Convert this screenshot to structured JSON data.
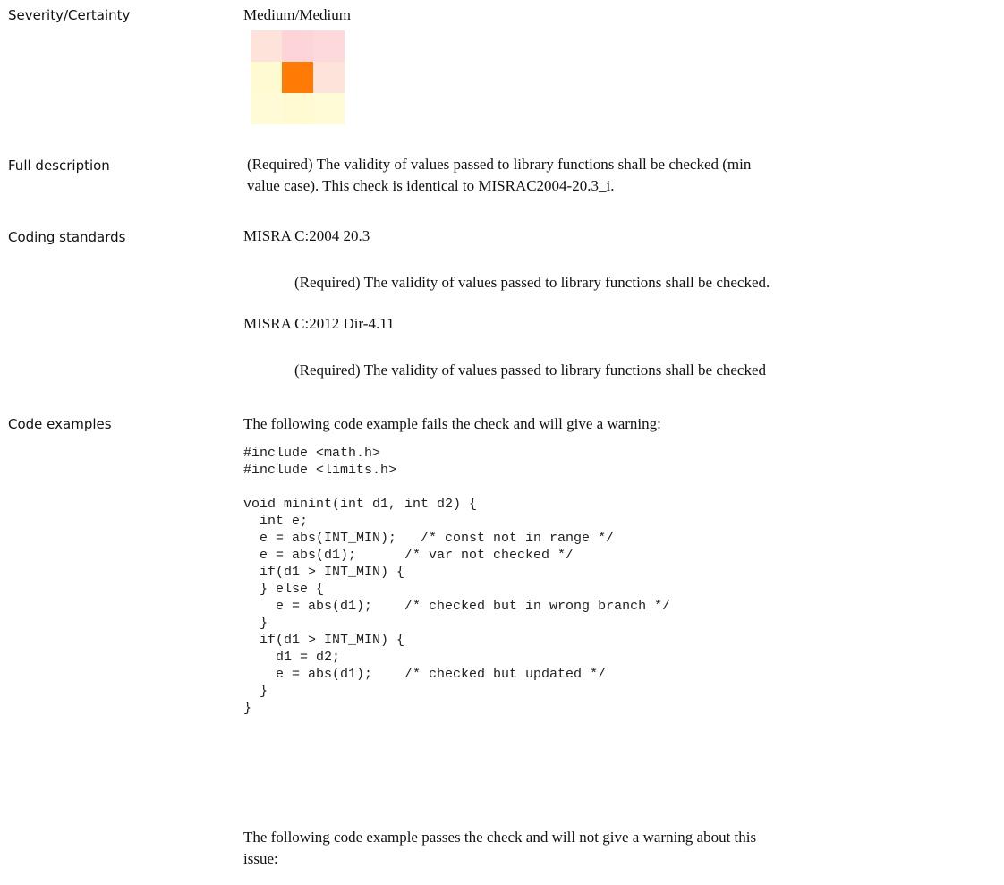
{
  "severity": {
    "label": "Severity/Certainty",
    "value": "Medium/Medium",
    "matrix": [
      [
        "#fde3da",
        "#fdd5d8",
        "#fdd9db"
      ],
      [
        "#fffad2",
        "#ff7b05",
        "#fde3da"
      ],
      [
        "#fffbd6",
        "#fffad2",
        "#fffbd6"
      ]
    ]
  },
  "full_description": {
    "label": "Full description",
    "text": "(Required) The validity of values passed to library functions shall be checked (min value case). This check is identical to MISRAC2004-20.3_i."
  },
  "coding_standards": {
    "label": "Coding standards",
    "items": [
      {
        "name": "MISRA C:2004 20.3",
        "desc": "(Required) The validity of values passed to library functions shall be checked."
      },
      {
        "name": "MISRA C:2012 Dir-4.11",
        "desc": "(Required) The validity of values passed to library functions shall be checked"
      }
    ]
  },
  "code_examples": {
    "label": "Code examples",
    "fail_intro": "The following code example fails the check and will give a warning:",
    "fail_code": "#include <math.h>\n#include <limits.h>\n\nvoid minint(int d1, int d2) {\n  int e;\n  e = abs(INT_MIN);   /* const not in range */\n  e = abs(d1);      /* var not checked */\n  if(d1 > INT_MIN) {\n  } else {\n    e = abs(d1);    /* checked but in wrong branch */\n  }\n  if(d1 > INT_MIN) {\n    d1 = d2;\n    e = abs(d1);    /* checked but updated */\n  }\n}",
    "pass_intro": "The following code example passes the check and will not give a warning about this issue:"
  }
}
